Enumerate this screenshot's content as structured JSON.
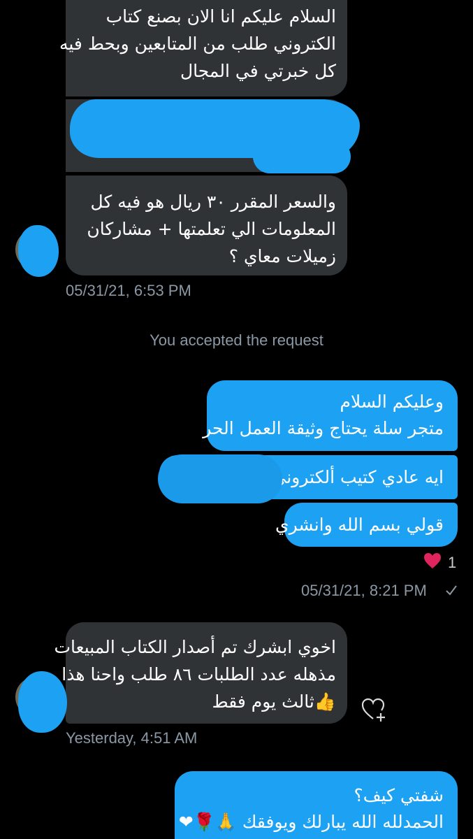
{
  "conversation": {
    "msg1": {
      "lines": [
        "السلام عليكم انا الان بصنع كتاب",
        "الكتروني طلب من المتابعين وبحط فيه",
        "كل خبرتي في المجال"
      ]
    },
    "msg2": {
      "lines": [
        "والسعر المقرر ٣٠ ريال هو فيه كل",
        "المعلومات الي تعلمتها + مشاركان",
        "زميلات معاي ؟"
      ],
      "timestamp": "05/31/21, 6:53 PM"
    },
    "system_notice": "You accepted the request",
    "out1": {
      "lines": [
        "وعليكم السلام",
        "متجر سلة يحتاج وثيقة العمل الحر"
      ]
    },
    "out2": {
      "text": "ايه عادي كتيب ألكتروني"
    },
    "out3": {
      "text": "قولي بسم الله وانشري",
      "reaction_count": "1",
      "timestamp": "05/31/21, 8:21 PM"
    },
    "msg3": {
      "lines": [
        "اخوي ابشرك تم أصدار الكتاب المبيعات",
        "مذهله عدد الطلبات ٨٦ طلب واحنا هذا",
        "ثالث يوم فقط"
      ],
      "emoji": "👍",
      "timestamp": "Yesterday, 4:51 AM"
    },
    "out4": {
      "lines": [
        "شفتي كيف؟",
        "الحمدلله الله يبارلك ويوفقك"
      ],
      "emoji": "🙏🌹❤"
    }
  },
  "colors": {
    "outgoing": "#1da1f2",
    "incoming": "#2f3336",
    "meta": "#8b98a5",
    "heart": "#e0245e"
  }
}
